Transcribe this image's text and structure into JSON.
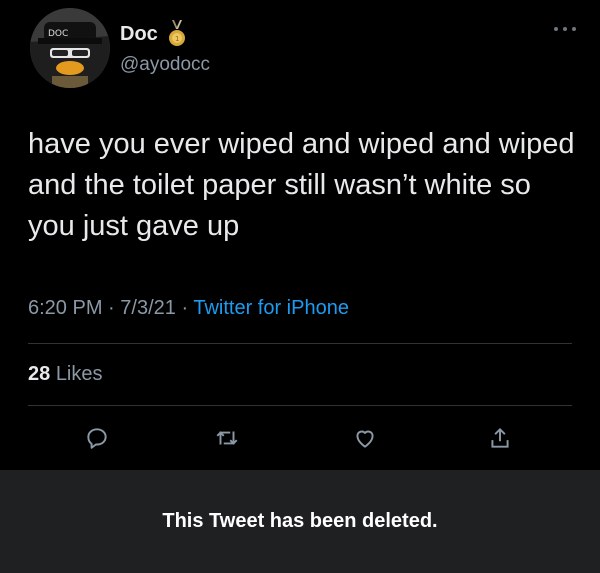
{
  "user": {
    "display_name": "Doc",
    "handle": "@ayodocc",
    "avatar_icon": "avatar-cartoon-character-icon",
    "badge_icon": "gold-medal-icon"
  },
  "tweet": {
    "text": "have you ever wiped and wiped and wiped and the toilet paper still wasn’t white so you just gave up",
    "time": "6:20 PM",
    "date": "7/3/21",
    "separator": "·",
    "source": "Twitter for iPhone",
    "likes_count": "28",
    "likes_label": "Likes"
  },
  "actions": [
    "reply-icon",
    "retweet-icon",
    "like-icon",
    "share-icon"
  ],
  "status": {
    "message": "This Tweet has been deleted."
  },
  "colors": {
    "background": "#000000",
    "text": "#e7e9ea",
    "secondary": "#8b98a5",
    "link": "#1d9bf0",
    "deleted_bar": "#1f2021"
  }
}
